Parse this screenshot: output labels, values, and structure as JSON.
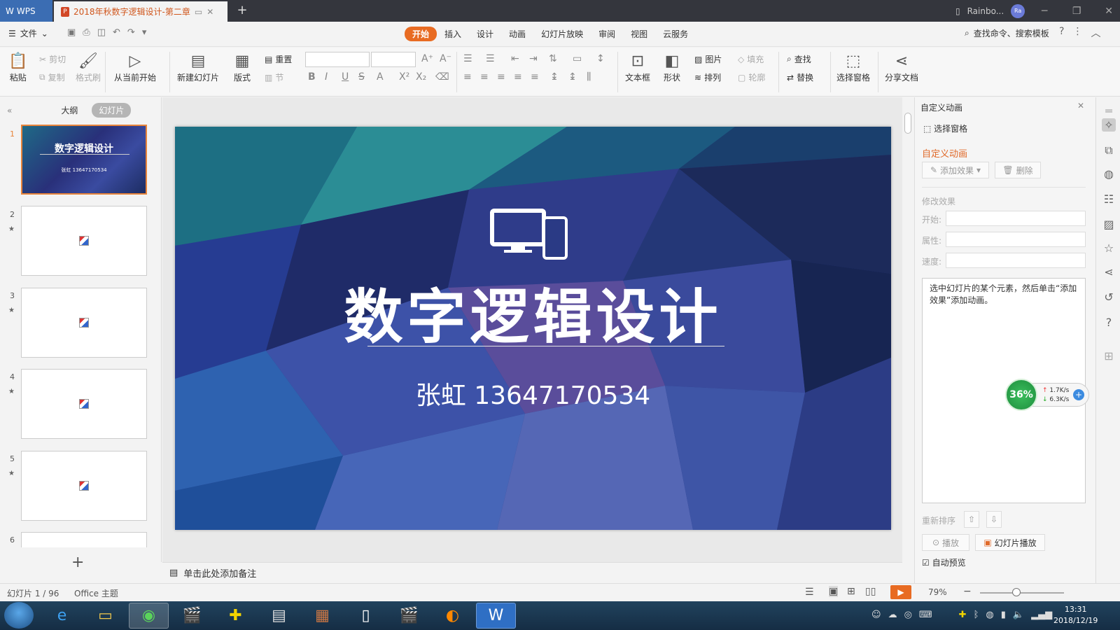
{
  "app": {
    "name": "WPS",
    "tab_title": "2018年秋数字逻辑设计-第二章",
    "user": "Rainbo...",
    "avatar": "Ra"
  },
  "menu": {
    "file": "文件",
    "tabs": [
      "开始",
      "插入",
      "设计",
      "动画",
      "幻灯片放映",
      "审阅",
      "视图",
      "云服务"
    ],
    "active_tab": "开始",
    "search": "查找命令、搜索模板"
  },
  "ribbon": {
    "paste": "粘贴",
    "cut": "剪切",
    "copy": "复制",
    "format_painter": "格式刷",
    "from_current": "从当前开始",
    "new_slide": "新建幻灯片",
    "layout": "版式",
    "reset": "重置",
    "section": "节",
    "textbox": "文本框",
    "shape": "形状",
    "picture": "图片",
    "arrange": "排列",
    "fill": "填充",
    "outline": "轮廓",
    "find": "查找",
    "replace": "替换",
    "select_pane": "选择窗格",
    "share": "分享文档"
  },
  "left": {
    "tab_outline": "大纲",
    "tab_slides": "幻灯片",
    "slide_numbers": [
      "1",
      "2",
      "3",
      "4",
      "5",
      "6"
    ],
    "thumb_title": "数字逻辑设计",
    "thumb_sub": "张虹  13647170534"
  },
  "slide": {
    "title": "数字逻辑设计",
    "subtitle": "张虹   13647170534"
  },
  "notes": {
    "placeholder": "单击此处添加备注"
  },
  "pane": {
    "header": "自定义动画",
    "select_pane": "选择窗格",
    "section_title": "自定义动画",
    "add_effect": "添加效果",
    "delete": "删除",
    "modify": "修改效果",
    "start": "开始:",
    "property": "属性:",
    "speed": "速度:",
    "hint": "选中幻灯片的某个元素，然后单击“添加效果”添加动画。",
    "reorder": "重新排序",
    "play": "播放",
    "slideshow": "幻灯片播放",
    "auto_preview": "自动预览"
  },
  "net": {
    "percent": "36%",
    "up": "1.7K/s",
    "down": "6.3K/s"
  },
  "status": {
    "slide_info": "幻灯片 1 / 96",
    "theme": "Office 主题",
    "zoom": "79%"
  },
  "taskbar": {
    "time": "13:31",
    "date": "2018/12/19"
  },
  "colors": {
    "accent": "#e86b22",
    "titlebar": "#34363d",
    "wps_blue": "#3b6db3"
  }
}
